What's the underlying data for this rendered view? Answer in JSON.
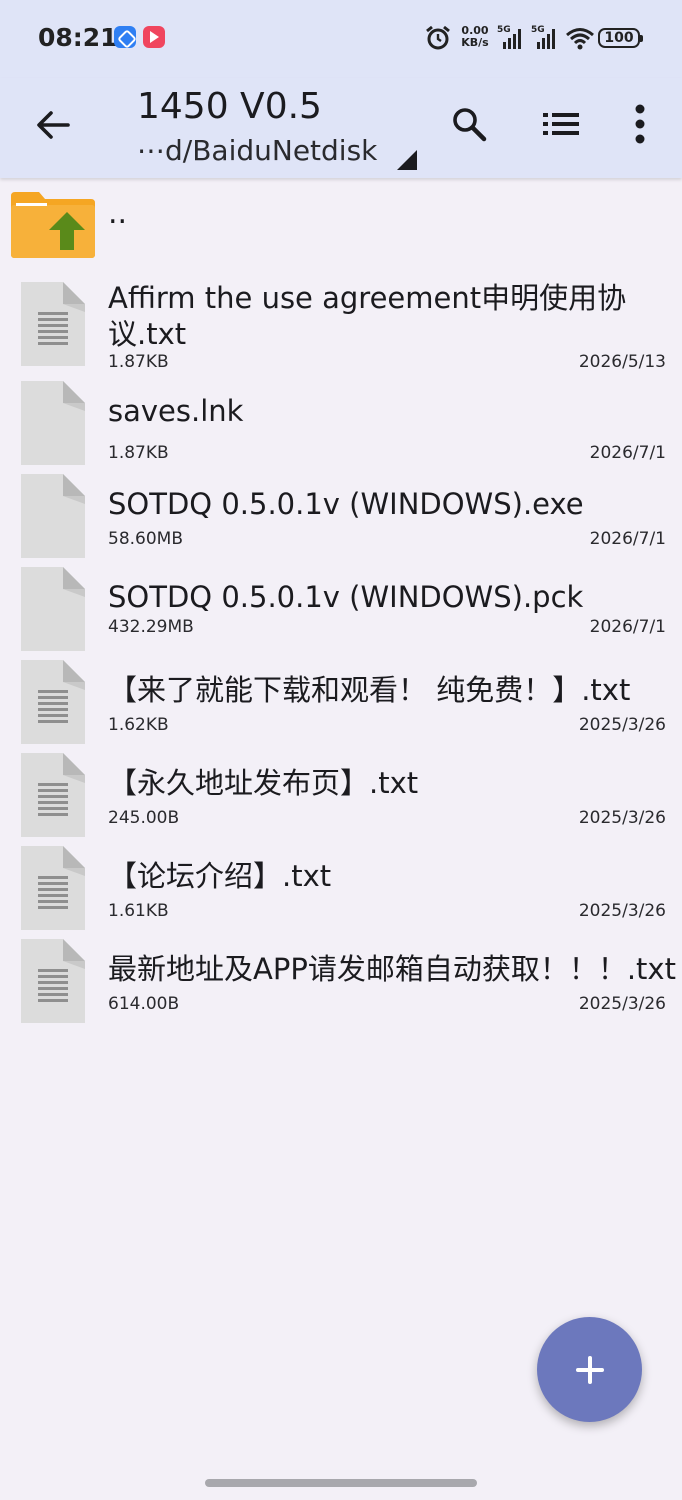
{
  "status_bar": {
    "time": "08:21",
    "net_speed_value": "0.00",
    "net_speed_unit": "KB/s",
    "signal1_label": "5G",
    "signal2_label": "5G",
    "battery": "100",
    "icons": [
      "app-notification-icon",
      "video-app-icon",
      "alarm-icon",
      "wifi-icon",
      "battery-icon"
    ]
  },
  "toolbar": {
    "title": "1450 V0.5",
    "path": "⋯d/BaiduNetdisk",
    "icons": [
      "back-arrow-icon",
      "search-icon",
      "list-view-icon",
      "more-vert-icon"
    ]
  },
  "list": {
    "parent_label": "..",
    "files": [
      {
        "name": "Affirm the use agreement申明使用协议.txt",
        "size": "1.87KB",
        "date": "2026/5/13",
        "icon": "text-file-icon"
      },
      {
        "name": "saves.lnk",
        "size": "1.87KB",
        "date": "2026/7/1",
        "icon": "file-icon"
      },
      {
        "name": "SOTDQ 0.5.0.1v (WINDOWS).exe",
        "size": "58.60MB",
        "date": "2026/7/1",
        "icon": "file-icon"
      },
      {
        "name": "SOTDQ 0.5.0.1v (WINDOWS).pck",
        "size": "432.29MB",
        "date": "2026/7/1",
        "icon": "file-icon"
      },
      {
        "name": "【来了就能下载和观看！ 纯免费！】.txt",
        "size": "1.62KB",
        "date": "2025/3/26",
        "icon": "text-file-icon"
      },
      {
        "name": "【永久地址发布页】.txt",
        "size": "245.00B",
        "date": "2025/3/26",
        "icon": "text-file-icon"
      },
      {
        "name": "【论坛介绍】.txt",
        "size": "1.61KB",
        "date": "2025/3/26",
        "icon": "text-file-icon"
      },
      {
        "name": "最新地址及APP请发邮箱自动获取！！！.txt",
        "size": "614.00B",
        "date": "2025/3/26",
        "icon": "text-file-icon"
      }
    ]
  },
  "colors": {
    "toolbar_bg": "#dfe4f7",
    "page_bg": "#f3f0f7",
    "fab_bg": "#6c78bd",
    "folder_orange": "#f5a623",
    "folder_arrow_green": "#5a8a1a"
  }
}
